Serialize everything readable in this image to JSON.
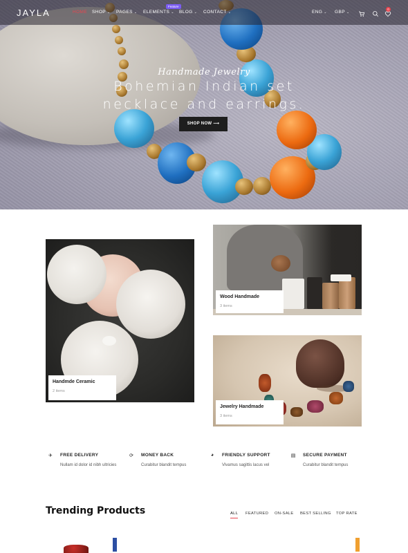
{
  "nav": {
    "logo": "JAYLA",
    "items": [
      {
        "label": "HOME",
        "active": true,
        "has_dropdown": false
      },
      {
        "label": "SHOP",
        "active": false,
        "has_dropdown": true
      },
      {
        "label": "PAGES",
        "active": false,
        "has_dropdown": true
      },
      {
        "label": "ELEMENTS",
        "active": false,
        "has_dropdown": true
      },
      {
        "label": "BLOG",
        "active": false,
        "has_dropdown": true
      },
      {
        "label": "CONTACT",
        "active": false,
        "has_dropdown": true
      }
    ],
    "elements_badge": "Feature",
    "language": "ENG",
    "currency": "GBP",
    "cart_count": "0",
    "icons": [
      "cart-icon",
      "search-icon",
      "wishlist-icon"
    ]
  },
  "hero": {
    "script_title": "Handmade Jewelry",
    "title_line1": "Bohemian Indian set",
    "title_line2": "necklace and earrings.",
    "button_label": "SHOP NOW ⟶"
  },
  "categories": [
    {
      "title": "Handmde Ceramic",
      "count": "2 items"
    },
    {
      "title": "Wood Handmade",
      "count": "3 items"
    },
    {
      "title": "Jewelry Handmade",
      "count": "3 items"
    }
  ],
  "features": [
    {
      "icon": "plane-icon",
      "title": "FREE DELIVERY",
      "desc": "Nullam id dolor id nibh ultricies"
    },
    {
      "icon": "refresh-icon",
      "title": "MONEY BACK",
      "desc": "Curabitur blandit tempus"
    },
    {
      "icon": "support-icon",
      "title": "FRIENDLY SUPPORT",
      "desc": "Vivamus sagittis lacus vel"
    },
    {
      "icon": "card-icon",
      "title": "SECURE PAYMENT",
      "desc": "Curabitur blandit tempus"
    }
  ],
  "trending": {
    "title": "Trending Products",
    "tabs": [
      "ALL",
      "FEATURED",
      "ON-SALE",
      "BEST SELLING",
      "TOP RATE"
    ],
    "active_tab": "ALL"
  },
  "colors": {
    "accent": "#e8454f",
    "badge": "#7b5cf2",
    "button": "#1e1e1e"
  }
}
